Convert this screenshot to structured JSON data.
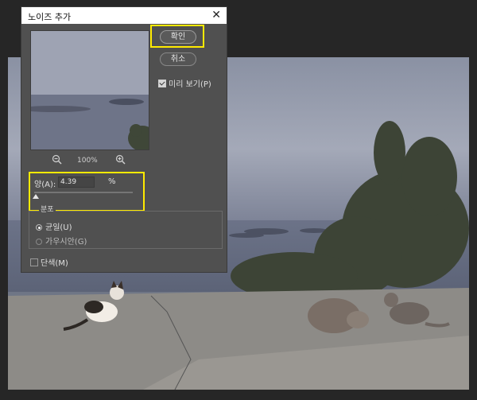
{
  "dialog": {
    "title": "노이즈 추가",
    "ok_label": "확인",
    "cancel_label": "취소",
    "preview_label": "미리 보기(P)",
    "zoom_level": "100%",
    "amount_label": "양(A):",
    "amount_value": "4.39",
    "amount_unit": "%",
    "amount_slider_fraction": 0.02,
    "distribution_label": "분포",
    "distribution_options": [
      "균일(U)",
      "가우시안(G)"
    ],
    "distribution_selected": "균일(U)",
    "monochromatic_label": "단색(M)",
    "preview_checked": true,
    "monochromatic_checked": false
  },
  "icons": {
    "close": "close-icon",
    "zoom_out": "zoom-out-icon",
    "zoom_in": "zoom-in-icon"
  },
  "colors": {
    "highlight": "#ffea00",
    "dialog_bg": "#505050",
    "workspace_bg": "#262626"
  }
}
